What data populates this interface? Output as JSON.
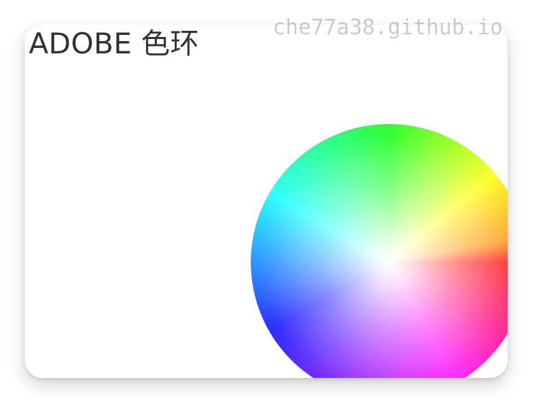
{
  "page": {
    "title": "ADOBE 色环",
    "watermark": "che77a38.github.io"
  },
  "icons": {
    "color_wheel": "color-wheel-icon"
  },
  "colors": {
    "card_background": "#ffffff",
    "title_text": "#333333",
    "watermark_text": "#cccccc"
  }
}
